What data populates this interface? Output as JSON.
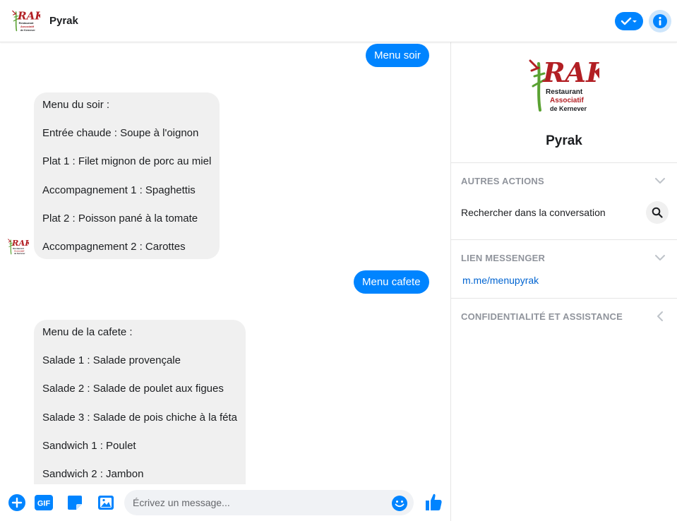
{
  "header": {
    "title": "Pyrak",
    "logo_icon": "rak-logo-icon",
    "status_icon": "check-dropdown-icon",
    "info_icon": "info-icon"
  },
  "logo": {
    "word": "RAK",
    "line1": "Restaurant",
    "line2": "Associatif",
    "line3": "de Kernever"
  },
  "chat": {
    "messages": [
      {
        "direction": "out",
        "text": "Menu soir"
      },
      {
        "direction": "in",
        "lines": [
          "Menu du soir :",
          "Entrée chaude : Soupe à l'oignon",
          "Plat 1 : Filet mignon de porc au miel",
          "Accompagnement 1 : Spaghettis",
          "Plat 2 : Poisson pané à la tomate",
          "Accompagnement 2 : Carottes"
        ]
      },
      {
        "direction": "out",
        "text": "Menu cafete"
      },
      {
        "direction": "in",
        "lines": [
          "Menu de la cafete :",
          "Salade 1 : Salade provençale",
          "Salade 2 : Salade de poulet aux figues",
          "Salade 3 : Salade de pois chiche à la féta",
          "Sandwich 1 : Poulet",
          "Sandwich 2 : Jambon"
        ]
      }
    ]
  },
  "composer": {
    "placeholder": "Écrivez un message...",
    "gif_label": "GIF",
    "icons": [
      "plus-icon",
      "gif-icon",
      "sticker-icon",
      "image-icon",
      "emoji-icon",
      "thumbs-up-icon"
    ]
  },
  "panel": {
    "name": "Pyrak",
    "sections": {
      "actions_title": "AUTRES ACTIONS",
      "search_label": "Rechercher dans la conversation",
      "messenger_title": "LIEN MESSENGER",
      "messenger_link": "m.me/menupyrak",
      "privacy_title": "CONFIDENTIALITÉ ET ASSISTANCE"
    }
  },
  "colors": {
    "accent": "#0084ff",
    "bubble_in": "#f0f0f0",
    "logo_red": "#b21f24",
    "logo_green": "#5aa232",
    "section_gray": "#90949c"
  }
}
